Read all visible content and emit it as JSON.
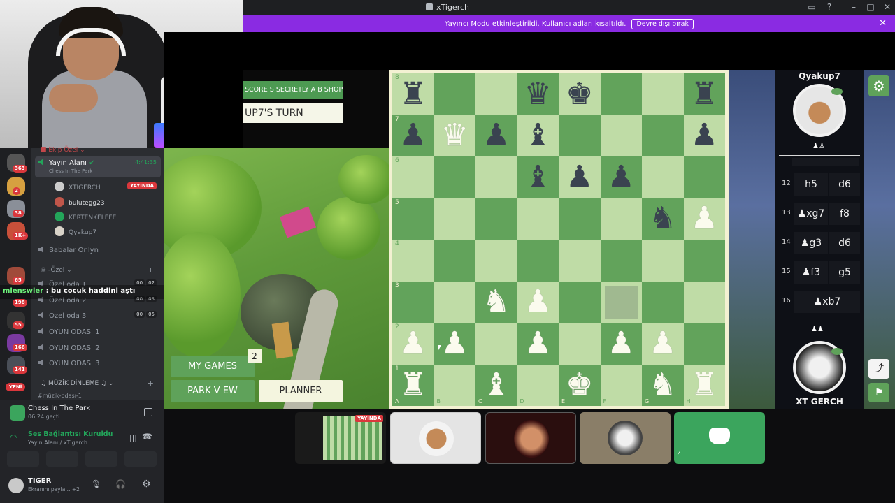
{
  "window": {
    "title": "xTigerch"
  },
  "notice": {
    "text": "Yayıncı Modu etkinleştirildi. Kullanıcı adları kısaltıldı.",
    "button": "Devre dışı bırak"
  },
  "chat_overlay": {
    "name": "mlenswler",
    "message": ": bu cocuk haddini aştı"
  },
  "rail": {
    "badges": [
      "363",
      "2",
      "38",
      "1K+",
      "65",
      "198",
      "55",
      "166",
      "141"
    ],
    "new_label": "YENİ"
  },
  "channels": {
    "team_category": "Ekip Özel",
    "stream_channel": {
      "name": "Yayın Alanı",
      "time": "4:41:35",
      "activity": "Chess In The Park"
    },
    "users": [
      {
        "name": "XTIGERCH",
        "live": "YAYINDA"
      },
      {
        "name": "bulutegg23"
      },
      {
        "name": "KERTENKELEFE"
      },
      {
        "name": "Qyakup7"
      }
    ],
    "babalar": "Babalar Onlyn",
    "private_category": "Özel",
    "private_rooms": [
      {
        "name": "Özel oda 1",
        "c1": "00",
        "c2": "02"
      },
      {
        "name": "Özel oda 2",
        "c1": "00",
        "c2": "03"
      },
      {
        "name": "Özel oda 3",
        "c1": "00",
        "c2": "05"
      }
    ],
    "game_rooms": [
      "OYUN ODASI 1",
      "OYUN ODASI 2",
      "OYUN ODASI 3"
    ],
    "music_category": "MÜZİK DİNLEME",
    "music_channel": "müzik-odası-1"
  },
  "bottom_panel": {
    "game_name": "Chess In The Park",
    "game_time": "06:24 geçti",
    "voice_status": "Ses Bağlantısı Kuruldu",
    "voice_sub": "Yayın Alanı / xTigerch",
    "username": "TIGER",
    "user_status": "Ekranını payla... +2"
  },
  "game": {
    "score_text": "SCORE  S SECRETLY A B SHOP",
    "turn_text": "UP7'S TURN",
    "my_games_label": "MY GAMES",
    "my_games_count": "2",
    "park_view_label": "PARK V EW",
    "planner_label": "PLANNER",
    "top_player": "Qyakup7",
    "bottom_player": "XT GERCH",
    "moves": [
      {
        "num": "12",
        "white": "h5",
        "black": "d6"
      },
      {
        "num": "13",
        "white": "♟xg7",
        "black": "f8"
      },
      {
        "num": "14",
        "white": "♟g3",
        "black": "d6"
      },
      {
        "num": "15",
        "white": "♟f3",
        "black": "g5"
      },
      {
        "num": "16",
        "white": "♟xb7",
        "black": ""
      }
    ],
    "ranks": [
      "8",
      "7",
      "6",
      "5",
      "4",
      "3",
      "2",
      "1"
    ],
    "files": [
      "A",
      "B",
      "C",
      "D",
      "E",
      "F",
      "G",
      "H"
    ],
    "board": [
      [
        "br",
        "",
        "",
        "bq",
        "bk",
        "",
        "",
        "br"
      ],
      [
        "bp",
        "wq",
        "bp",
        "bb",
        "",
        "",
        "",
        "bp"
      ],
      [
        "",
        "",
        "",
        "bb",
        "bp",
        "bp",
        "",
        ""
      ],
      [
        "",
        "",
        "",
        "",
        "",
        "",
        "bn",
        "wp"
      ],
      [
        "",
        "",
        "",
        "",
        "",
        "",
        "",
        ""
      ],
      [
        "",
        "",
        "wn",
        "wp",
        "",
        "hl",
        "",
        ""
      ],
      [
        "wp",
        "wp",
        "",
        "wp",
        "",
        "wp",
        "wp",
        ""
      ],
      [
        "wr",
        "",
        "wb",
        "",
        "wk",
        "",
        "wn",
        "wr"
      ]
    ]
  },
  "colors": {
    "accent": "#8a2be2",
    "board_light": "#bfdca6",
    "board_dark": "#62a35b",
    "live_red": "#da373c",
    "discord_green": "#23a55a"
  }
}
